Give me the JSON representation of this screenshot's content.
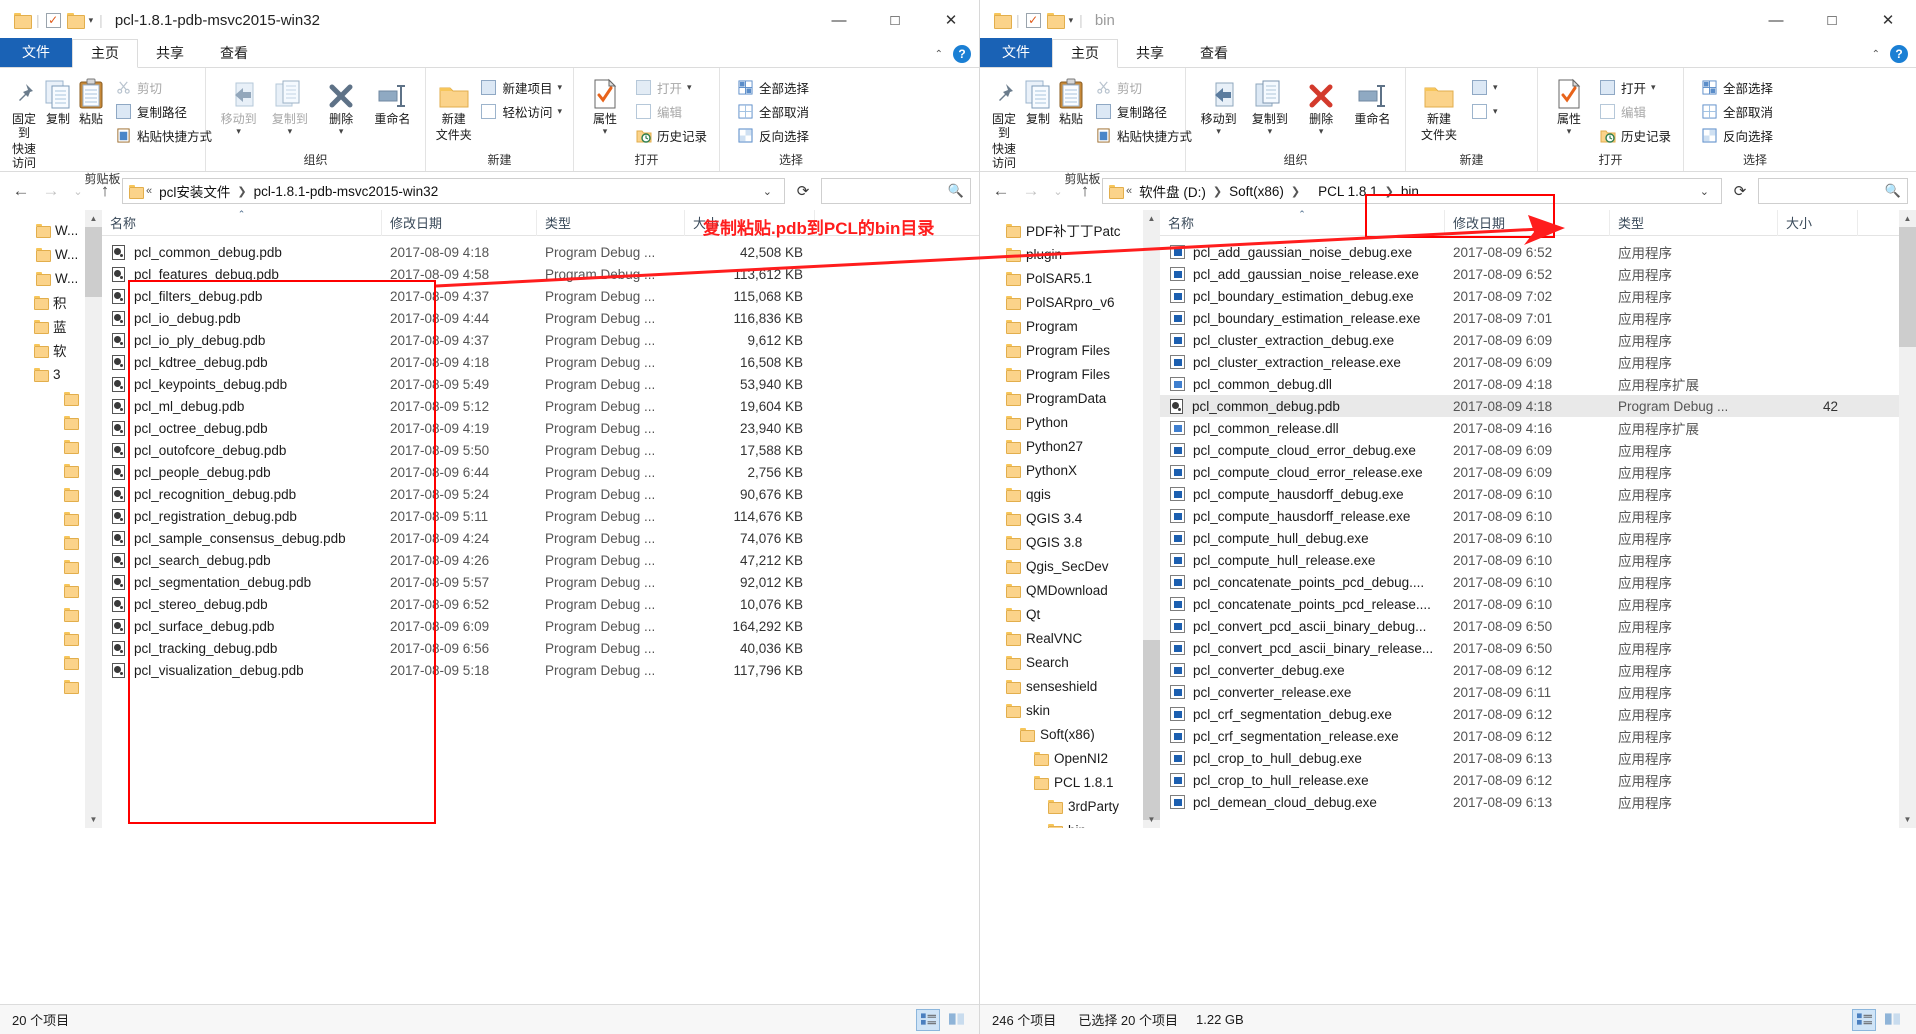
{
  "left": {
    "title": "pcl-1.8.1-pdb-msvc2015-win32",
    "tabs": {
      "file": "文件",
      "home": "主页",
      "share": "共享",
      "view": "查看"
    },
    "window_buttons": {
      "minimize": "—",
      "maximize": "□",
      "close": "✕"
    },
    "ribbon": {
      "clipboard": {
        "label": "剪贴板",
        "pin": "固定到\n快速访问",
        "pin_l1": "固定到",
        "pin_l2": "快速访问",
        "copy": "复制",
        "paste": "粘贴",
        "cut": "剪切",
        "copy_path": "复制路径",
        "paste_shortcut": "粘贴快捷方式"
      },
      "organize": {
        "label": "组织",
        "move_to": "移动到",
        "copy_to": "复制到",
        "delete": "删除",
        "rename": "重命名"
      },
      "new": {
        "label": "新建",
        "new_folder_l1": "新建",
        "new_folder_l2": "文件夹",
        "new_item": "新建项目",
        "easy_access": "轻松访问"
      },
      "open": {
        "label": "打开",
        "properties": "属性",
        "open": "打开",
        "edit": "编辑",
        "history": "历史记录"
      },
      "select": {
        "label": "选择",
        "select_all": "全部选择",
        "select_none": "全部取消",
        "invert": "反向选择"
      }
    },
    "address": {
      "crumbs": [
        "pcl安装文件",
        "pcl-1.8.1-pdb-msvc2015-win32"
      ],
      "prefix": "«"
    },
    "nav_stub": [
      "W...",
      "W...",
      "W...",
      "积",
      "蓝",
      "软",
      "3"
    ],
    "columns": {
      "name": "名称",
      "date": "修改日期",
      "type": "类型",
      "size": "大小"
    },
    "files": [
      {
        "name": "pcl_common_debug.pdb",
        "date": "2017-08-09 4:18",
        "type": "Program Debug ...",
        "size": "42,508 KB"
      },
      {
        "name": "pcl_features_debug.pdb",
        "date": "2017-08-09 4:58",
        "type": "Program Debug ...",
        "size": "113,612 KB"
      },
      {
        "name": "pcl_filters_debug.pdb",
        "date": "2017-08-09 4:37",
        "type": "Program Debug ...",
        "size": "115,068 KB"
      },
      {
        "name": "pcl_io_debug.pdb",
        "date": "2017-08-09 4:44",
        "type": "Program Debug ...",
        "size": "116,836 KB"
      },
      {
        "name": "pcl_io_ply_debug.pdb",
        "date": "2017-08-09 4:37",
        "type": "Program Debug ...",
        "size": "9,612 KB"
      },
      {
        "name": "pcl_kdtree_debug.pdb",
        "date": "2017-08-09 4:18",
        "type": "Program Debug ...",
        "size": "16,508 KB"
      },
      {
        "name": "pcl_keypoints_debug.pdb",
        "date": "2017-08-09 5:49",
        "type": "Program Debug ...",
        "size": "53,940 KB"
      },
      {
        "name": "pcl_ml_debug.pdb",
        "date": "2017-08-09 5:12",
        "type": "Program Debug ...",
        "size": "19,604 KB"
      },
      {
        "name": "pcl_octree_debug.pdb",
        "date": "2017-08-09 4:19",
        "type": "Program Debug ...",
        "size": "23,940 KB"
      },
      {
        "name": "pcl_outofcore_debug.pdb",
        "date": "2017-08-09 5:50",
        "type": "Program Debug ...",
        "size": "17,588 KB"
      },
      {
        "name": "pcl_people_debug.pdb",
        "date": "2017-08-09 6:44",
        "type": "Program Debug ...",
        "size": "2,756 KB"
      },
      {
        "name": "pcl_recognition_debug.pdb",
        "date": "2017-08-09 5:24",
        "type": "Program Debug ...",
        "size": "90,676 KB"
      },
      {
        "name": "pcl_registration_debug.pdb",
        "date": "2017-08-09 5:11",
        "type": "Program Debug ...",
        "size": "114,676 KB"
      },
      {
        "name": "pcl_sample_consensus_debug.pdb",
        "date": "2017-08-09 4:24",
        "type": "Program Debug ...",
        "size": "74,076 KB"
      },
      {
        "name": "pcl_search_debug.pdb",
        "date": "2017-08-09 4:26",
        "type": "Program Debug ...",
        "size": "47,212 KB"
      },
      {
        "name": "pcl_segmentation_debug.pdb",
        "date": "2017-08-09 5:57",
        "type": "Program Debug ...",
        "size": "92,012 KB"
      },
      {
        "name": "pcl_stereo_debug.pdb",
        "date": "2017-08-09 6:52",
        "type": "Program Debug ...",
        "size": "10,076 KB"
      },
      {
        "name": "pcl_surface_debug.pdb",
        "date": "2017-08-09 6:09",
        "type": "Program Debug ...",
        "size": "164,292 KB"
      },
      {
        "name": "pcl_tracking_debug.pdb",
        "date": "2017-08-09 6:56",
        "type": "Program Debug ...",
        "size": "40,036 KB"
      },
      {
        "name": "pcl_visualization_debug.pdb",
        "date": "2017-08-09 5:18",
        "type": "Program Debug ...",
        "size": "117,796 KB"
      }
    ],
    "status": {
      "items": "20 个项目"
    }
  },
  "right": {
    "title": "bin",
    "tabs": {
      "file": "文件",
      "home": "主页",
      "share": "共享",
      "view": "查看"
    },
    "window_buttons": {
      "minimize": "—",
      "maximize": "□",
      "close": "✕"
    },
    "address": {
      "prefix": "«",
      "crumbs": [
        "软件盘 (D:)",
        "Soft(x86)",
        "PCL 1.8.1",
        "bin"
      ]
    },
    "nav_tree": [
      "PDF补丁丁Patc",
      "plugin",
      "PolSAR5.1",
      "PolSARpro_v6",
      "Program",
      "Program Files",
      "Program Files",
      "ProgramData",
      "Python",
      "Python27",
      "PythonX",
      "qgis",
      "QGIS 3.4",
      "QGIS 3.8",
      "Qgis_SecDev",
      "QMDownload",
      "Qt",
      "RealVNC",
      "Search",
      "senseshield",
      "skin",
      "Soft(x86)",
      "OpenNI2",
      "PCL 1.8.1",
      "3rdParty",
      "bin"
    ],
    "columns": {
      "name": "名称",
      "date": "修改日期",
      "type": "类型",
      "size": "大小"
    },
    "files": [
      {
        "name": "pcl_add_gaussian_noise_debug.exe",
        "date": "2017-08-09 6:52",
        "type": "应用程序",
        "icon": "exe",
        "size": ""
      },
      {
        "name": "pcl_add_gaussian_noise_release.exe",
        "date": "2017-08-09 6:52",
        "type": "应用程序",
        "icon": "exe",
        "size": ""
      },
      {
        "name": "pcl_boundary_estimation_debug.exe",
        "date": "2017-08-09 7:02",
        "type": "应用程序",
        "icon": "exe",
        "size": ""
      },
      {
        "name": "pcl_boundary_estimation_release.exe",
        "date": "2017-08-09 7:01",
        "type": "应用程序",
        "icon": "exe",
        "size": ""
      },
      {
        "name": "pcl_cluster_extraction_debug.exe",
        "date": "2017-08-09 6:09",
        "type": "应用程序",
        "icon": "exe",
        "size": ""
      },
      {
        "name": "pcl_cluster_extraction_release.exe",
        "date": "2017-08-09 6:09",
        "type": "应用程序",
        "icon": "exe",
        "size": ""
      },
      {
        "name": "pcl_common_debug.dll",
        "date": "2017-08-09 4:18",
        "type": "应用程序扩展",
        "icon": "dll",
        "size": ""
      },
      {
        "name": "pcl_common_debug.pdb",
        "date": "2017-08-09 4:18",
        "type": "Program Debug ...",
        "icon": "pdb",
        "size": "42",
        "selected": true
      },
      {
        "name": "pcl_common_release.dll",
        "date": "2017-08-09 4:16",
        "type": "应用程序扩展",
        "icon": "dll",
        "size": ""
      },
      {
        "name": "pcl_compute_cloud_error_debug.exe",
        "date": "2017-08-09 6:09",
        "type": "应用程序",
        "icon": "exe",
        "size": ""
      },
      {
        "name": "pcl_compute_cloud_error_release.exe",
        "date": "2017-08-09 6:09",
        "type": "应用程序",
        "icon": "exe",
        "size": ""
      },
      {
        "name": "pcl_compute_hausdorff_debug.exe",
        "date": "2017-08-09 6:10",
        "type": "应用程序",
        "icon": "exe",
        "size": ""
      },
      {
        "name": "pcl_compute_hausdorff_release.exe",
        "date": "2017-08-09 6:10",
        "type": "应用程序",
        "icon": "exe",
        "size": ""
      },
      {
        "name": "pcl_compute_hull_debug.exe",
        "date": "2017-08-09 6:10",
        "type": "应用程序",
        "icon": "exe",
        "size": ""
      },
      {
        "name": "pcl_compute_hull_release.exe",
        "date": "2017-08-09 6:10",
        "type": "应用程序",
        "icon": "exe",
        "size": ""
      },
      {
        "name": "pcl_concatenate_points_pcd_debug....",
        "date": "2017-08-09 6:10",
        "type": "应用程序",
        "icon": "exe",
        "size": ""
      },
      {
        "name": "pcl_concatenate_points_pcd_release....",
        "date": "2017-08-09 6:10",
        "type": "应用程序",
        "icon": "exe",
        "size": ""
      },
      {
        "name": "pcl_convert_pcd_ascii_binary_debug...",
        "date": "2017-08-09 6:50",
        "type": "应用程序",
        "icon": "exe",
        "size": ""
      },
      {
        "name": "pcl_convert_pcd_ascii_binary_release...",
        "date": "2017-08-09 6:50",
        "type": "应用程序",
        "icon": "exe",
        "size": ""
      },
      {
        "name": "pcl_converter_debug.exe",
        "date": "2017-08-09 6:12",
        "type": "应用程序",
        "icon": "exe",
        "size": ""
      },
      {
        "name": "pcl_converter_release.exe",
        "date": "2017-08-09 6:11",
        "type": "应用程序",
        "icon": "exe",
        "size": ""
      },
      {
        "name": "pcl_crf_segmentation_debug.exe",
        "date": "2017-08-09 6:12",
        "type": "应用程序",
        "icon": "exe",
        "size": ""
      },
      {
        "name": "pcl_crf_segmentation_release.exe",
        "date": "2017-08-09 6:12",
        "type": "应用程序",
        "icon": "exe",
        "size": ""
      },
      {
        "name": "pcl_crop_to_hull_debug.exe",
        "date": "2017-08-09 6:13",
        "type": "应用程序",
        "icon": "exe",
        "size": ""
      },
      {
        "name": "pcl_crop_to_hull_release.exe",
        "date": "2017-08-09 6:12",
        "type": "应用程序",
        "icon": "exe",
        "size": ""
      },
      {
        "name": "pcl_demean_cloud_debug.exe",
        "date": "2017-08-09 6:13",
        "type": "应用程序",
        "icon": "exe",
        "size": ""
      }
    ],
    "status": {
      "items": "246 个项目",
      "selected": "已选择 20 个项目",
      "size": "1.22 GB"
    }
  },
  "annotation": {
    "text": "复制粘贴.pdb到PCL的bin目录",
    "color": "#ff1d1d"
  }
}
